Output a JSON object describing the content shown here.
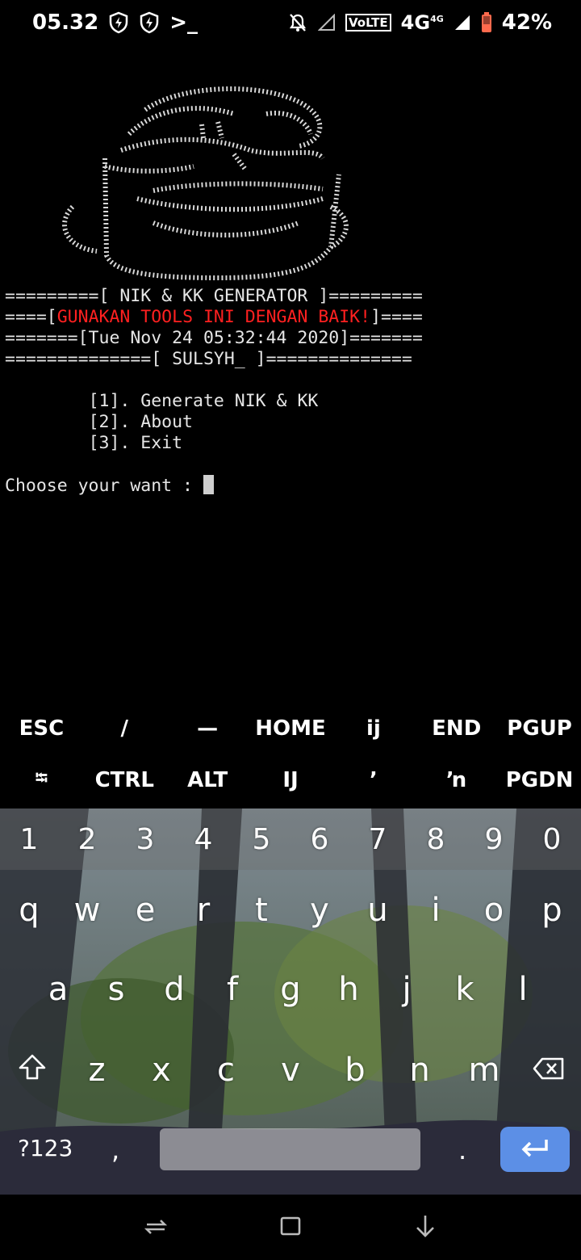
{
  "status_bar": {
    "time": "05.32",
    "terminal_glyph": ">_",
    "volte": "VoLTE",
    "network": "4G",
    "network_small": "4G",
    "battery": "42%"
  },
  "terminal": {
    "banner_lines": [
      "=========[ NIK & KK GENERATOR ]=========",
      "====[GUNAKAN TOOLS INI DENGAN BAIK!]====",
      "=======[Tue Nov 24 05:32:44 2020]=======",
      "==============[ SULSYH_ ]=============="
    ],
    "warning_prefix": "====[",
    "warning_text": "GUNAKAN TOOLS INI DENGAN BAIK!",
    "warning_suffix": "]====",
    "menu_items": [
      "[1]. Generate NIK & KK",
      "[2]. About",
      "[3]. Exit"
    ],
    "prompt": "Choose your want : "
  },
  "extra_keys": {
    "row1": [
      "ESC",
      "/",
      "—",
      "HOME",
      "ĳ",
      "END",
      "PGUP"
    ],
    "row2": [
      "⭾",
      "CTRL",
      "ALT",
      "Ĳ",
      "’",
      "ŉ",
      "PGDN"
    ]
  },
  "keyboard": {
    "numbers": [
      "1",
      "2",
      "3",
      "4",
      "5",
      "6",
      "7",
      "8",
      "9",
      "0"
    ],
    "row1": [
      "q",
      "w",
      "e",
      "r",
      "t",
      "y",
      "u",
      "i",
      "o",
      "p"
    ],
    "row2": [
      "a",
      "s",
      "d",
      "f",
      "g",
      "h",
      "j",
      "k",
      "l"
    ],
    "row3": [
      "z",
      "x",
      "c",
      "v",
      "b",
      "n",
      "m"
    ],
    "symbols_key": "?123",
    "comma": ",",
    "period": "."
  },
  "icons": {
    "status": [
      "shield-icon",
      "shield-icon",
      "terminal-icon",
      "mute-icon",
      "signal-icon",
      "battery-icon"
    ],
    "nav": [
      "recent-apps-icon",
      "home-icon",
      "back-icon"
    ]
  }
}
